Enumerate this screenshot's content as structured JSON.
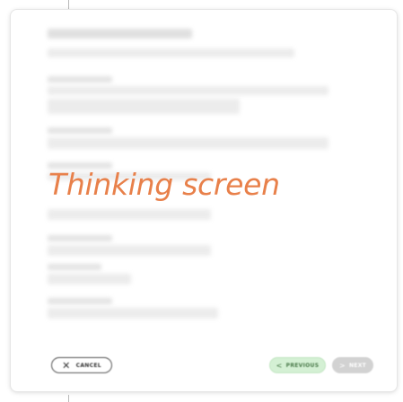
{
  "overlay_text": "Thinking screen",
  "footer": {
    "cancel_label": "CANCEL",
    "previous_label": "PREVIOUS",
    "next_label": "NEXT"
  },
  "icons": {
    "cancel": "close-icon",
    "previous": "chevron-left-icon",
    "next": "chevron-right-icon"
  },
  "colors": {
    "overlay_text": "#e8804a",
    "previous_bg": "#d4f0d4",
    "next_bg": "#d2d2d2",
    "placeholder": "#ececec"
  }
}
